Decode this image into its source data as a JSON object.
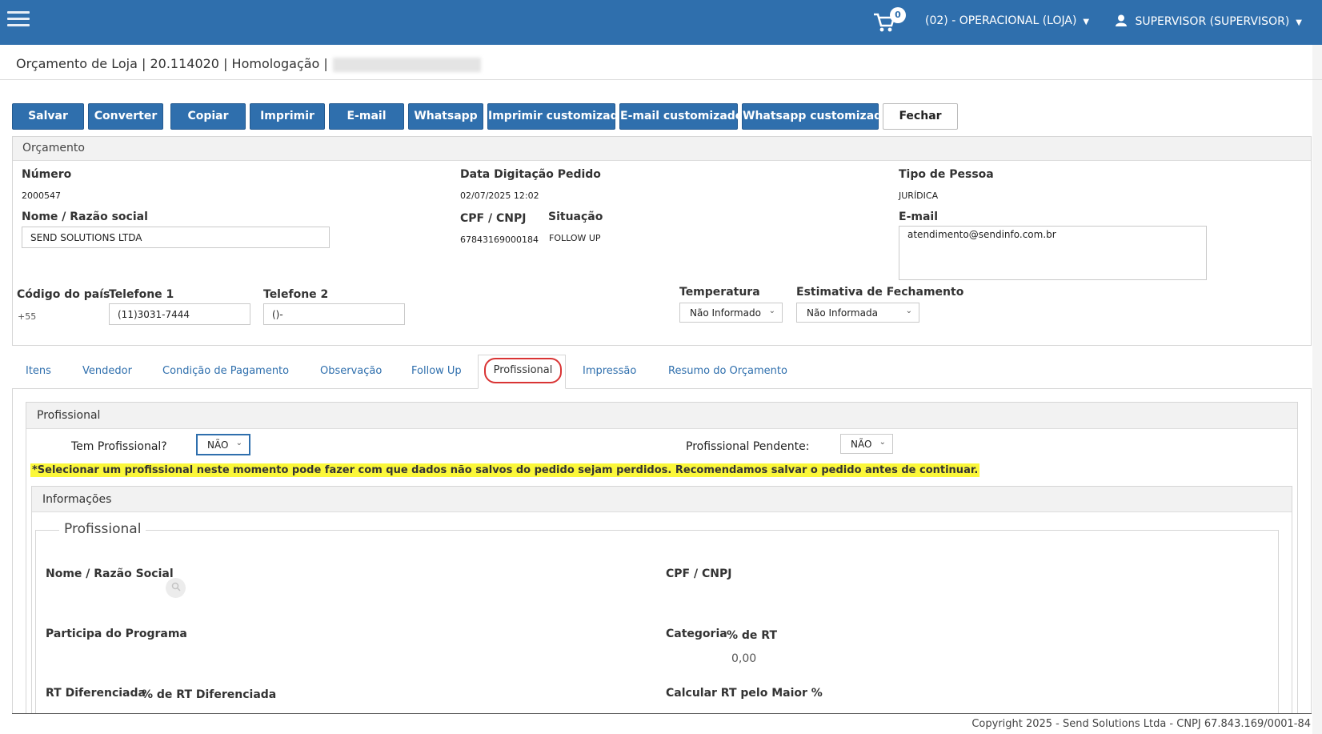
{
  "header": {
    "cart_count": "0",
    "store_label": "(02) - OPERACIONAL (LOJA)",
    "user_label": "SUPERVISOR (SUPERVISOR)",
    "color_bar": "#2f6fad"
  },
  "page_title": "Orçamento de Loja | 20.114020 | Homologação |",
  "toolbar": {
    "buttons": [
      "Salvar",
      "Converter",
      "Copiar",
      "Imprimir",
      "E-mail",
      "Whatsapp",
      "Imprimir customizado",
      "E-mail customizado",
      "Whatsapp customizado",
      "Fechar"
    ]
  },
  "orcamento": {
    "panel_title": "Orçamento",
    "numero_label": "Número",
    "numero_value": "2000547",
    "data_label": "Data Digitação Pedido",
    "data_value": "02/07/2025 12:02",
    "tipo_label": "Tipo de Pessoa",
    "tipo_value": "JURÍDICA",
    "nome_label": "Nome / Razão social",
    "nome_value": "SEND SOLUTIONS LTDA",
    "cpf_label": "CPF / CNPJ",
    "cpf_value": "67843169000184",
    "situacao_label": "Situação",
    "situacao_value": "FOLLOW UP",
    "email_label": "E-mail",
    "email_value": "atendimento@sendinfo.com.br",
    "codigo_pais_label": "Código do país",
    "codigo_pais_value": "+55",
    "telefone1_label": "Telefone 1",
    "telefone1_value": "(11)3031-7444",
    "telefone2_label": "Telefone 2",
    "telefone2_value": "()-",
    "temperatura_label": "Temperatura",
    "temperatura_value": "Não Informado",
    "estimativa_label": "Estimativa de Fechamento",
    "estimativa_value": "Não Informada"
  },
  "tabs": [
    "Itens",
    "Vendedor",
    "Condição de Pagamento",
    "Observação",
    "Follow Up",
    "Profissional",
    "Impressão",
    "Resumo do Orçamento"
  ],
  "profissional": {
    "panel_title": "Profissional",
    "tem_label": "Tem Profissional?",
    "tem_value": "NÃO",
    "pendente_label": "Profissional Pendente:",
    "pendente_value": "NÃO",
    "warning": "*Selecionar um profissional neste momento pode fazer com que dados não salvos do pedido sejam perdidos. Recomendamos salvar o pedido antes de continuar.",
    "info_title": "Informações",
    "legend": "Profissional",
    "nome_label": "Nome / Razão Social",
    "cpf_label": "CPF / CNPJ",
    "participa_label": "Participa do Programa",
    "categoria_label": "Categoria",
    "rt_label": "% de RT",
    "rt_value": "0,00",
    "rt_dif_label": "RT Diferenciada",
    "rt_dif_pct_label": "% de RT Diferenciada",
    "calc_label": "Calcular RT pelo Maior %"
  },
  "footer": "Copyright 2025 - Send Solutions Ltda - CNPJ 67.843.169/0001-84"
}
